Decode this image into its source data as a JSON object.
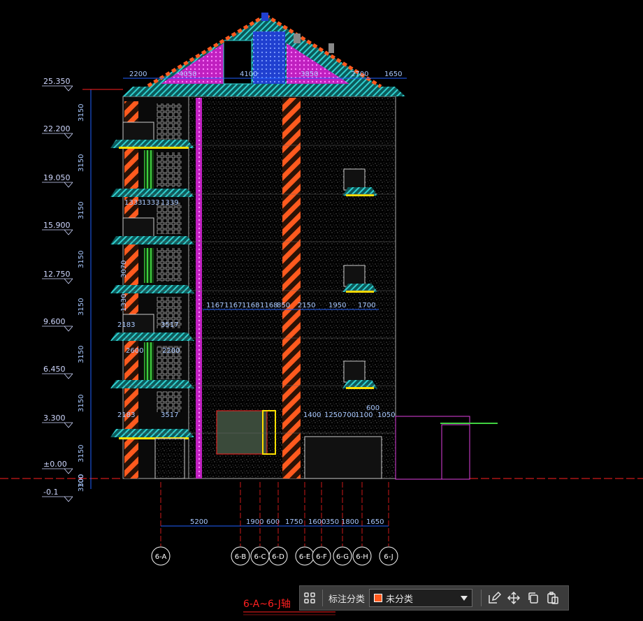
{
  "colors": {
    "background": "#000000",
    "grid_blue": "#2060ff",
    "dimension": "#a8c8ff",
    "roof_cyan": "#20b0b0",
    "magenta": "#e040e0",
    "orange": "#ff5a1e",
    "green": "#40d040",
    "yellow": "#ffe000",
    "red": "#ff2020"
  },
  "elevations": [
    "25.350",
    "22.200",
    "19.050",
    "15.900",
    "12.750",
    "9.600",
    "6.450",
    "3.300",
    "±0.00",
    "-0.1"
  ],
  "floor_heights": [
    "3150",
    "3150",
    "3150",
    "3150",
    "3150",
    "3150",
    "3150",
    "3150",
    "3300",
    "100"
  ],
  "top_dims": [
    "2200",
    "4050",
    "4100",
    "3850",
    "2700",
    "1650"
  ],
  "inner_dims": {
    "row_1333": [
      "1333",
      "1333",
      "1339"
    ],
    "row_1167": [
      "1167",
      "1167",
      "1168",
      "1168",
      "850",
      "2150",
      "1950",
      "1700"
    ],
    "row_2183a": [
      "2183",
      "3517"
    ],
    "row_2600": [
      "2600",
      "2200"
    ],
    "row_2183b": [
      "2183",
      "3517"
    ],
    "row_1400": [
      "1400",
      "1250",
      "700",
      "1100",
      "1050"
    ],
    "dim_600": "600",
    "vert_3070": "3070",
    "vert_1330": "1330"
  },
  "bottom_dims": [
    "5200",
    "1900",
    "600",
    "1750",
    "1600",
    "350",
    "1800",
    "1650"
  ],
  "axis_labels": [
    "6-A",
    "6-B",
    "6-C",
    "6-D",
    "6-E",
    "6-F",
    "6-G",
    "6-H",
    "6-J"
  ],
  "title_text": "6-A~6-J轴",
  "toolbar": {
    "grid_icon": "grid-icon",
    "label": "标注分类",
    "select_value": "未分类",
    "select_swatch": "#ff5a1e",
    "actions": [
      "edit-icon",
      "move-icon",
      "copy-icon",
      "paste-icon"
    ]
  }
}
